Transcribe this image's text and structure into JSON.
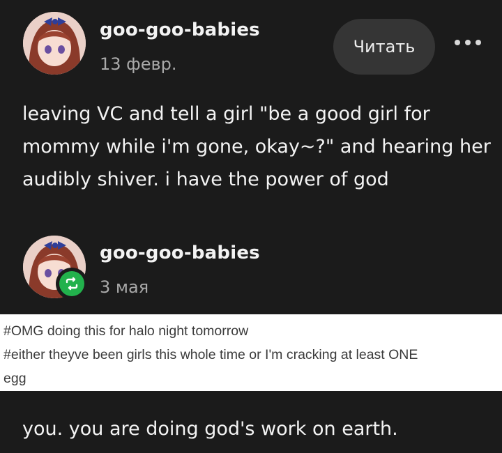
{
  "post": {
    "author": "goo-goo-babies",
    "date": "13 февр.",
    "follow_label": "Читать",
    "body": "leaving VC and tell a girl \"be a good girl for mommy while i'm gone, okay~?\" and hearing her audibly shiver. i have the power of god"
  },
  "reblog": {
    "author": "goo-goo-babies",
    "date": "3 мая",
    "tags": [
      "#OMG doing this for halo night tomorrow",
      "#either theyve been girls this whole time or I'm cracking at least ONE",
      "egg"
    ],
    "body": "you.  you are doing god's work on earth."
  },
  "colors": {
    "background": "#1b1b1b",
    "button": "#353535",
    "reblog_green": "#22b14c",
    "tags_background": "#ffffff"
  },
  "icons": {
    "more": "more-dots-icon",
    "reblog": "reblog-icon"
  }
}
